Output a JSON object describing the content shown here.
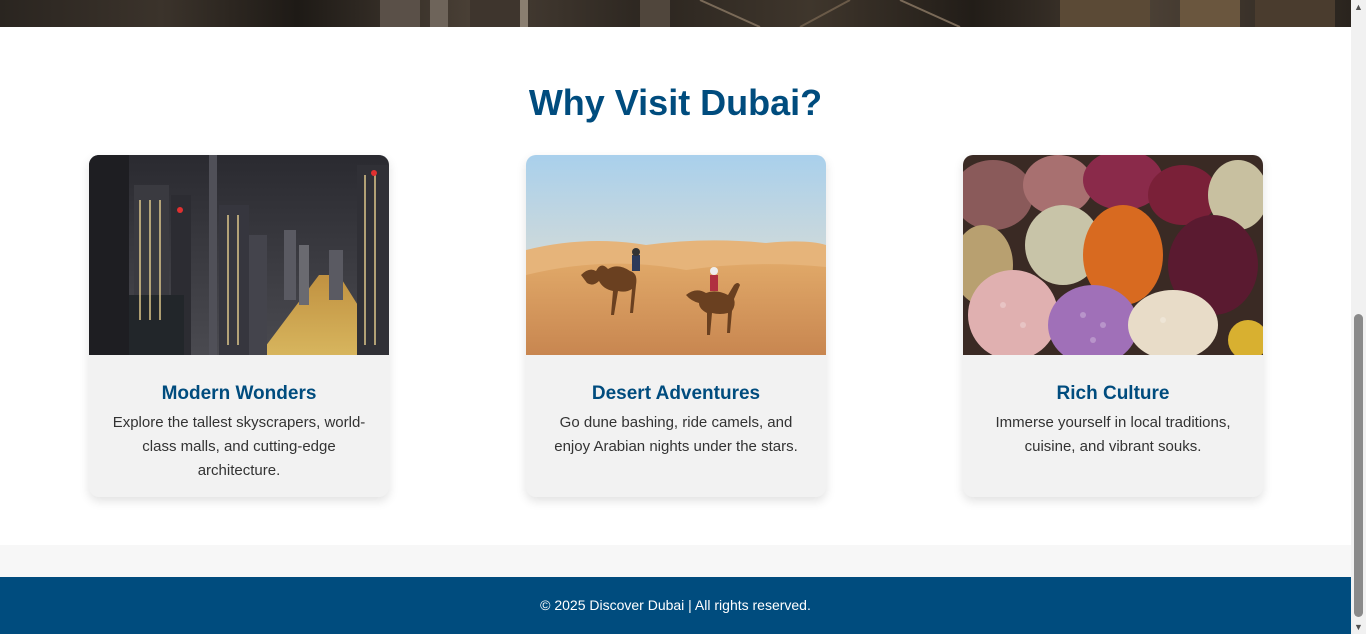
{
  "section": {
    "title": "Why Visit Dubai?"
  },
  "cards": [
    {
      "title": "Modern Wonders",
      "text": "Explore the tallest skyscrapers, world-class malls, and cutting-edge architecture.",
      "image": "dubai-skyline-night-photo"
    },
    {
      "title": "Desert Adventures",
      "text": "Go dune bashing, ride camels, and enjoy Arabian nights under the stars.",
      "image": "desert-camels-photo"
    },
    {
      "title": "Rich Culture",
      "text": "Immerse yourself in local traditions, cuisine, and vibrant souks.",
      "image": "spice-souk-photo"
    }
  ],
  "footer": {
    "text": "© 2025 Discover Dubai | All rights reserved."
  },
  "colors": {
    "accent": "#004c7e",
    "card_bg": "#f2f2f2",
    "footer_bg": "#004c7e"
  },
  "scrollbar": {
    "up_icon": "scroll-up-arrow-icon",
    "down_icon": "scroll-down-arrow-icon"
  }
}
